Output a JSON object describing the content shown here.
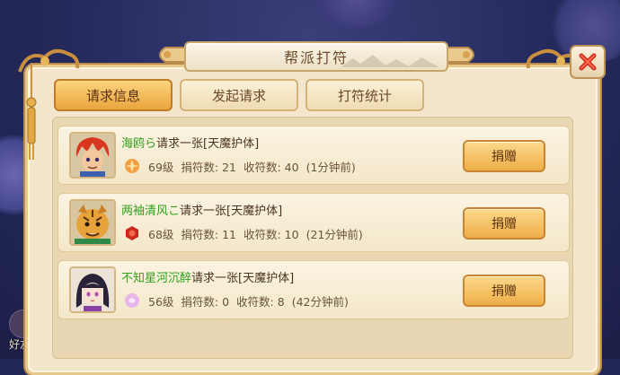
{
  "window": {
    "title": "帮派打符",
    "close_icon": "close-x-icon"
  },
  "background": {
    "friend_label": "好友"
  },
  "tabs": [
    {
      "label": "请求信息",
      "active": true
    },
    {
      "label": "发起请求",
      "active": false
    },
    {
      "label": "打符统计",
      "active": false
    }
  ],
  "requests": [
    {
      "name": "海鸥ら",
      "request_text": "请求一张[天魔护体]",
      "level": "69级",
      "donated": "捐符数: 21",
      "received": "收符数: 40",
      "time": "(1分钟前)",
      "badge_icon": "orange-emblem-icon",
      "button": "捐赠"
    },
    {
      "name": "两袖清风こ",
      "request_text": "请求一张[天魔护体]",
      "level": "68级",
      "donated": "捐符数: 11",
      "received": "收符数: 10",
      "time": "(21分钟前)",
      "badge_icon": "red-emblem-icon",
      "button": "捐赠"
    },
    {
      "name": "不知星河沉醉",
      "request_text": "请求一张[天魔护体]",
      "level": "56级",
      "donated": "捐符数: 0",
      "received": "收符数: 8",
      "time": "(42分钟前)",
      "badge_icon": "pink-emblem-icon",
      "button": "捐赠"
    }
  ],
  "colors": {
    "player_name": "#2d9f1a",
    "active_tab": "#eaa53e",
    "panel_bg": "#f3e6cc"
  }
}
